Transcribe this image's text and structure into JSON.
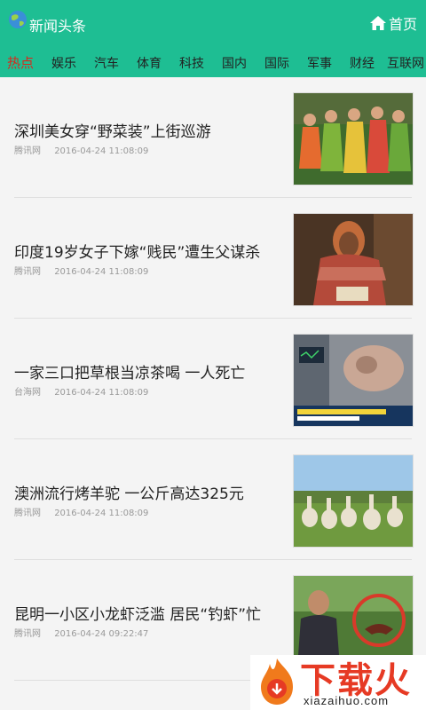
{
  "header": {
    "title": "新闻头条",
    "home_label": "首页"
  },
  "tabs": [
    {
      "label": "热点",
      "active": true
    },
    {
      "label": "娱乐"
    },
    {
      "label": "汽车"
    },
    {
      "label": "体育"
    },
    {
      "label": "科技"
    },
    {
      "label": "国内"
    },
    {
      "label": "国际"
    },
    {
      "label": "军事"
    },
    {
      "label": "财经"
    },
    {
      "label": "互联网"
    }
  ],
  "news": [
    {
      "title": "深圳美女穿“野菜装”上街巡游",
      "source": "腾讯网",
      "time": "2016-04-24 11:08:09"
    },
    {
      "title": "印度19岁女子下嫁“贱民”遭生父谋杀",
      "source": "腾讯网",
      "time": "2016-04-24 11:08:09"
    },
    {
      "title": "一家三口把草根当凉茶喝 一人死亡",
      "source": "台海网",
      "time": "2016-04-24 11:08:09"
    },
    {
      "title": "澳洲流行烤羊驼 一公斤高达325元",
      "source": "腾讯网",
      "time": "2016-04-24 11:08:09"
    },
    {
      "title": "昆明一小区小龙虾泛滥 居民“钓虾”忙",
      "source": "腾讯网",
      "time": "2016-04-24 09:22:47"
    }
  ],
  "watermark": {
    "text": "下载火",
    "url": "xiazaihuo.com"
  }
}
